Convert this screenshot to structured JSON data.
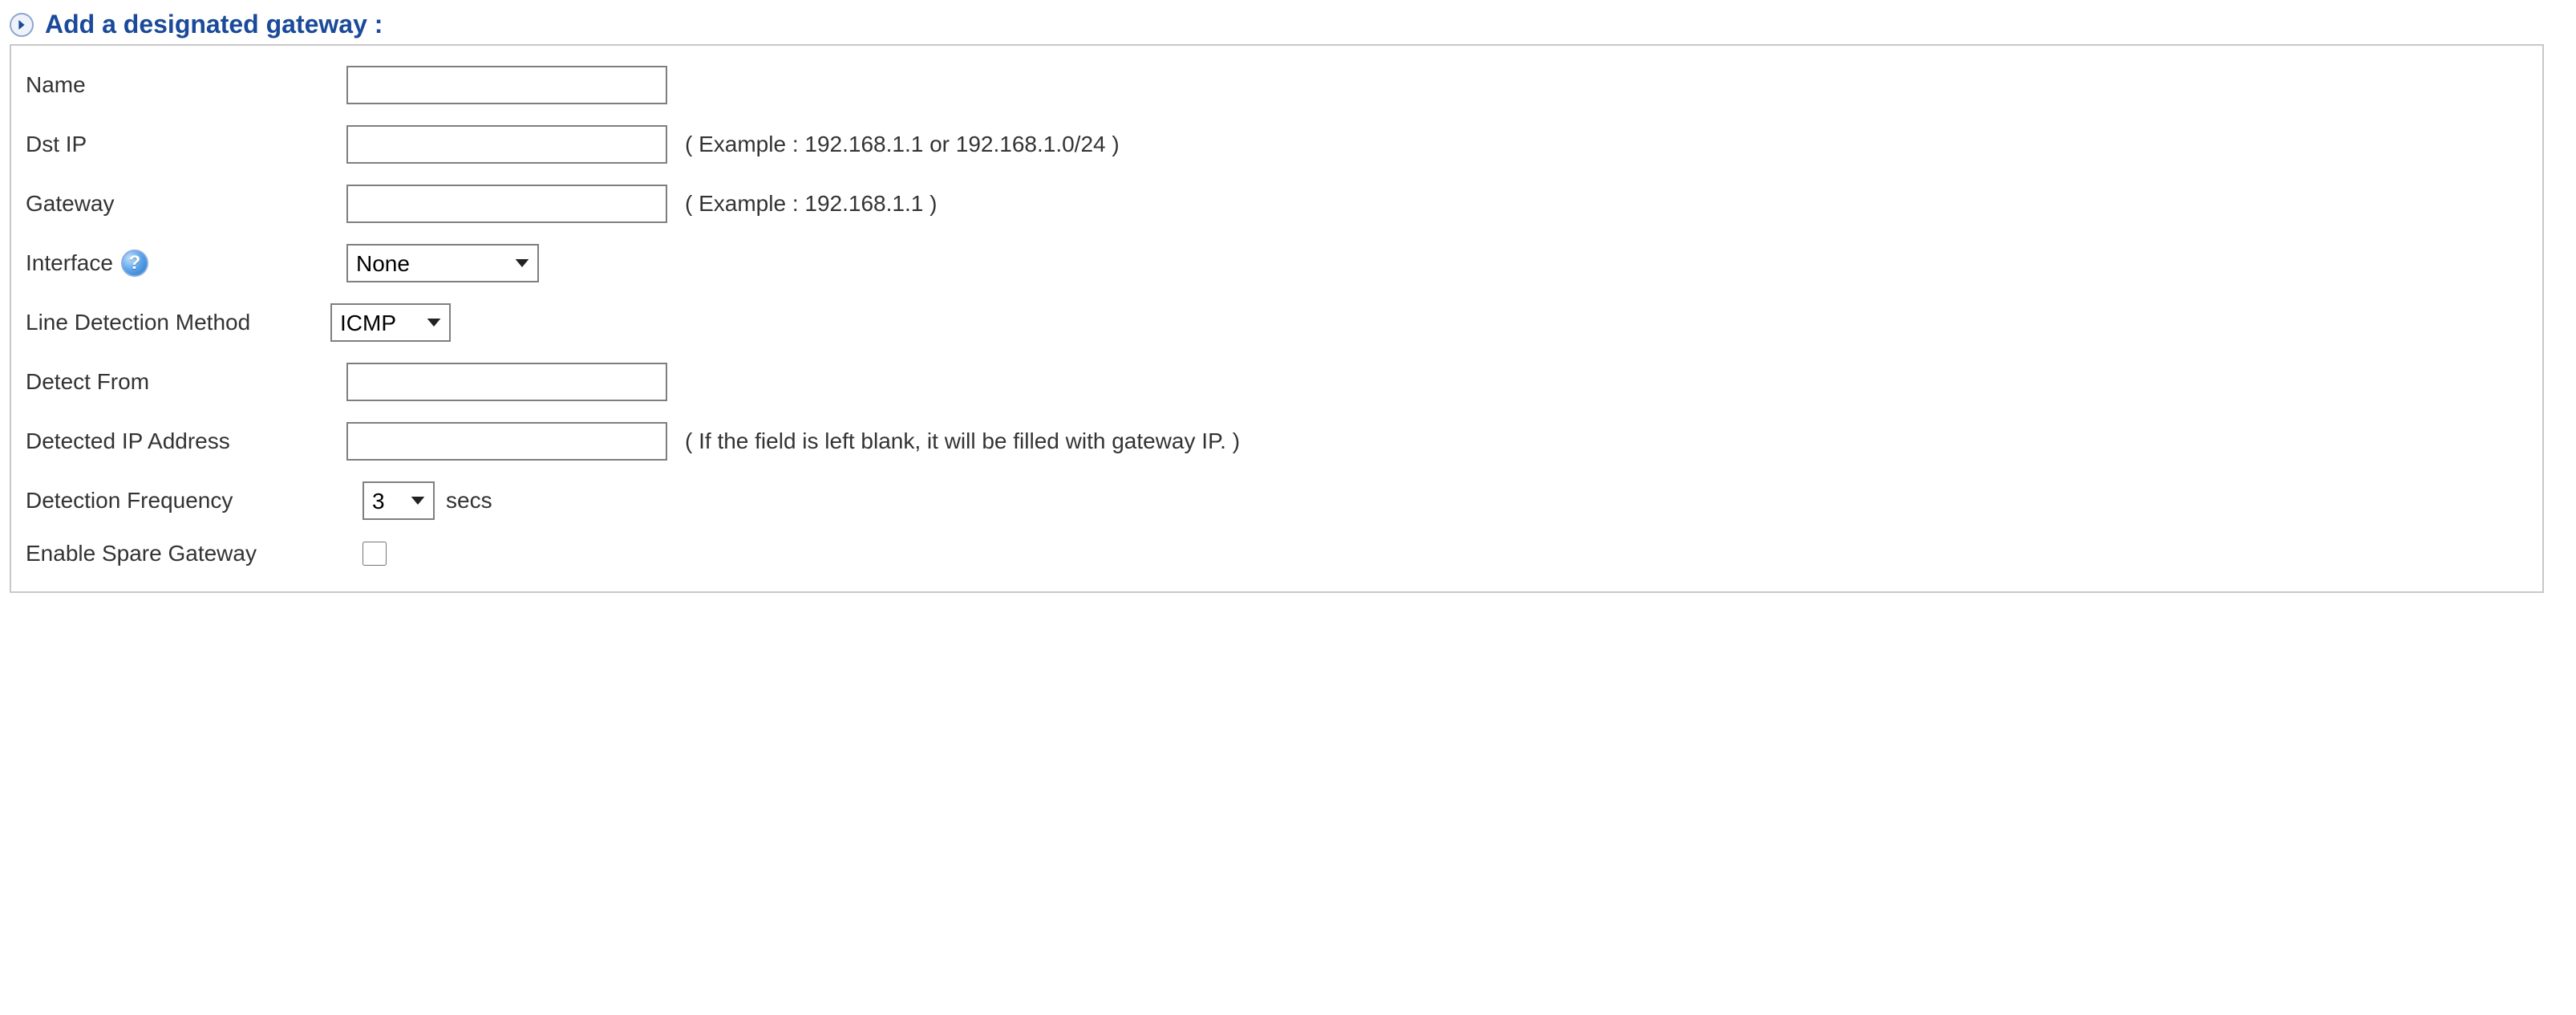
{
  "section": {
    "title": "Add a designated gateway :"
  },
  "fields": {
    "name": {
      "label": "Name",
      "value": ""
    },
    "dstip": {
      "label": "Dst IP",
      "value": "",
      "hint": "( Example : 192.168.1.1 or 192.168.1.0/24 )"
    },
    "gateway": {
      "label": "Gateway",
      "value": "",
      "hint": "( Example : 192.168.1.1 )"
    },
    "interface": {
      "label": "Interface",
      "value": "None"
    },
    "line_detection": {
      "label": "Line Detection Method",
      "value": "ICMP"
    },
    "detect_from": {
      "label": "Detect From",
      "value": ""
    },
    "detected_ip": {
      "label": "Detected IP Address",
      "value": "",
      "hint": "( If the field is left blank, it will be filled with gateway IP. )"
    },
    "detection_freq": {
      "label": "Detection Frequency",
      "value": "3",
      "unit": "secs"
    },
    "enable_spare": {
      "label": "Enable Spare Gateway"
    }
  }
}
